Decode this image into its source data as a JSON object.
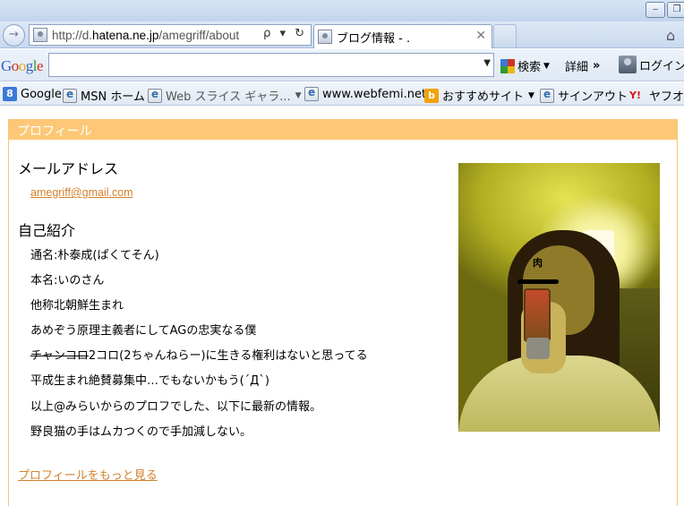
{
  "browser": {
    "address_prefix": "http://d.",
    "address_host": "hatena.ne.jp",
    "address_path": "/amegriff/about",
    "address_tools": "ρ ▾ ↻",
    "tab_title": "ブログ情報 - .",
    "tab_close": "✕",
    "minimize": "‒",
    "restore": "❐",
    "forward_icon": "→"
  },
  "google_toolbar": {
    "logo": "Google",
    "search_label": "検索",
    "details_label": "詳細",
    "login_label": "ログイン",
    "more_arrows": "»"
  },
  "favorites": [
    {
      "label": "Google",
      "icon": "google-icon"
    },
    {
      "label": "MSN ホーム",
      "icon": "ie-icon"
    },
    {
      "label": "Web スライス ギャラ...",
      "icon": "ie-icon"
    },
    {
      "label": "www.webfemi.net",
      "icon": "ie-icon"
    },
    {
      "label": "おすすめサイト",
      "icon": "bing-icon"
    },
    {
      "label": "サインアウト",
      "icon": "ie-icon"
    },
    {
      "label": "ヤフオク",
      "icon": "yahoo-icon"
    }
  ],
  "profile": {
    "header": "プロフィール",
    "email_heading": "メールアドレス",
    "email": "amegriff@gmail.com",
    "intro_heading": "自己紹介",
    "intro_lines": [
      "通名:朴泰成(ぱくてそん)",
      "本名:いのさん",
      "他称北朝鮮生まれ",
      "あめぞう原理主義者にしてAGの忠実なる僕",
      "2ちゃんねらー)に生きる権利はないと思ってる",
      "平成生まれ絶賛募集中…でもないかもう(´Д`)",
      "以上@みらいからのプロフでした、以下に最新の情報。",
      "野良猫の手はムカつくので手加減しない。"
    ],
    "struck_prefix": "チャンコロ",
    "struck_middle": "2コロ(",
    "more_link": "プロフィールをもっと見る",
    "photo_caption": "肉"
  },
  "colors": {
    "accent": "#fcc877",
    "link": "#d3812c"
  }
}
